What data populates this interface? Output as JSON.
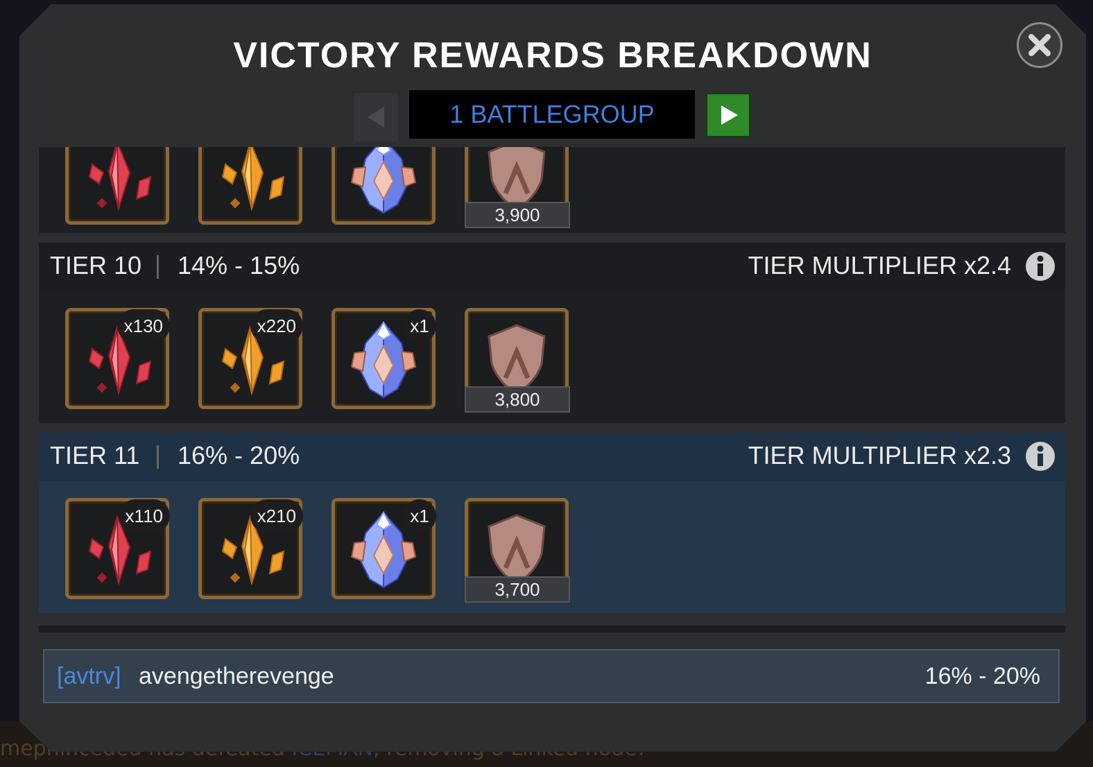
{
  "background": {
    "ticker_left": "mephinceded has defeated ",
    "ticker_highlight": "ICEMAN",
    "ticker_right": ", removing a Linked node!"
  },
  "dialog": {
    "title": "VICTORY REWARDS BREAKDOWN",
    "close_icon": "close-x-icon",
    "navigation": {
      "current": "1 BATTLEGROUP",
      "prev_icon": "triangle-left-icon",
      "next_icon": "triangle-right-icon",
      "next_color": "#2f8a2a"
    }
  },
  "tiers": [
    {
      "label": "",
      "range": "",
      "multiplier": "",
      "shield_value": "3,900",
      "rows_partial": true,
      "items": [
        {
          "icon": "red-crystal-shards-icon",
          "count": ""
        },
        {
          "icon": "gold-crystal-shards-icon",
          "count": ""
        },
        {
          "icon": "blue-crystal-icon",
          "count": ""
        }
      ]
    },
    {
      "label": "TIER 10",
      "range": "14% - 15%",
      "multiplier": "TIER MULTIPLIER x2.4",
      "shield_value": "3,800",
      "items": [
        {
          "icon": "red-crystal-shards-icon",
          "count": "x130"
        },
        {
          "icon": "gold-crystal-shards-icon",
          "count": "x220"
        },
        {
          "icon": "blue-crystal-icon",
          "count": "x1"
        }
      ]
    },
    {
      "label": "TIER 11",
      "range": "16% - 20%",
      "multiplier": "TIER MULTIPLIER x2.3",
      "shield_value": "3,700",
      "highlighted": true,
      "items": [
        {
          "icon": "red-crystal-shards-icon",
          "count": "x110"
        },
        {
          "icon": "gold-crystal-shards-icon",
          "count": "x210"
        },
        {
          "icon": "blue-crystal-icon",
          "count": "x1"
        }
      ]
    }
  ],
  "footer": {
    "tag": "[avtrv]",
    "player": "avengetherevenge",
    "range": "16% - 20%"
  },
  "colors": {
    "highlight_row": "#1e2f40",
    "row": "#1e1f22",
    "accent_blue": "#3f7ee0"
  }
}
